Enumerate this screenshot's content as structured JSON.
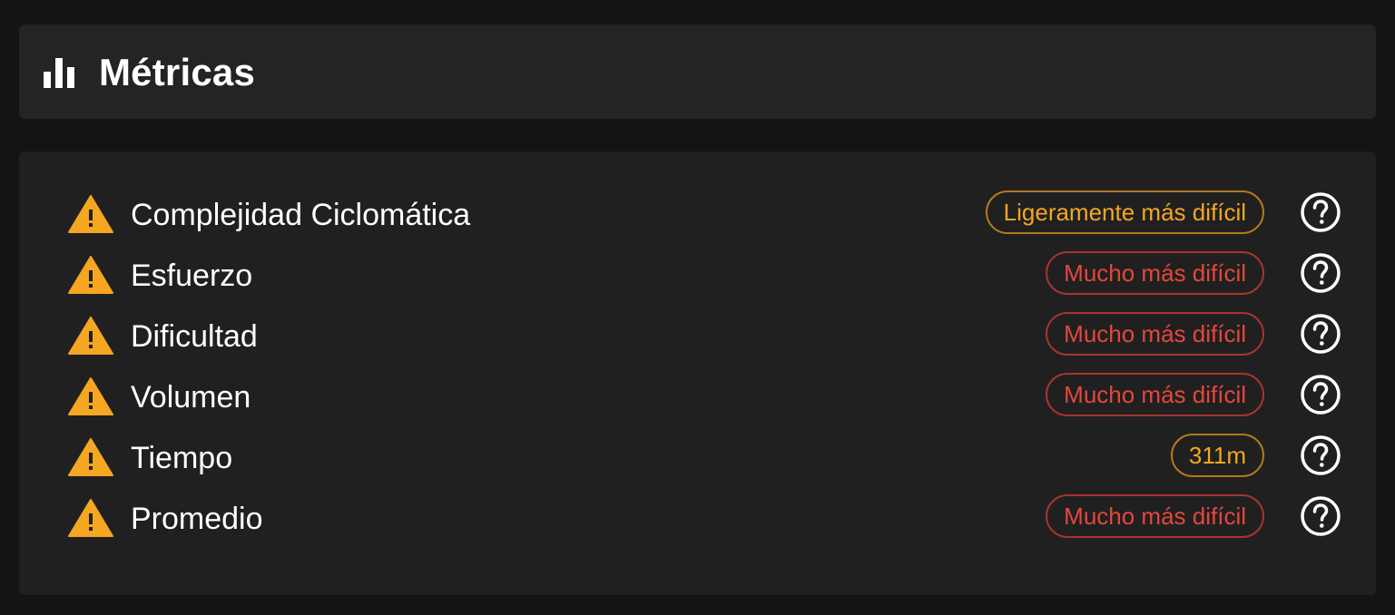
{
  "header": {
    "title": "Métricas",
    "icon": "bar-chart-icon"
  },
  "metrics": [
    {
      "label": "Complejidad Ciclomática",
      "status": "Ligeramente más difícil",
      "severity": "orange"
    },
    {
      "label": "Esfuerzo",
      "status": "Mucho más difícil",
      "severity": "red"
    },
    {
      "label": "Dificultad",
      "status": "Mucho más difícil",
      "severity": "red"
    },
    {
      "label": "Volumen",
      "status": "Mucho más difícil",
      "severity": "red"
    },
    {
      "label": "Tiempo",
      "status": "311m",
      "severity": "orange"
    },
    {
      "label": "Promedio",
      "status": "Mucho más difícil",
      "severity": "red"
    }
  ],
  "colors": {
    "warning": "#f5a623",
    "danger": "#e4473d",
    "background": "#141414",
    "card": "#202020"
  }
}
